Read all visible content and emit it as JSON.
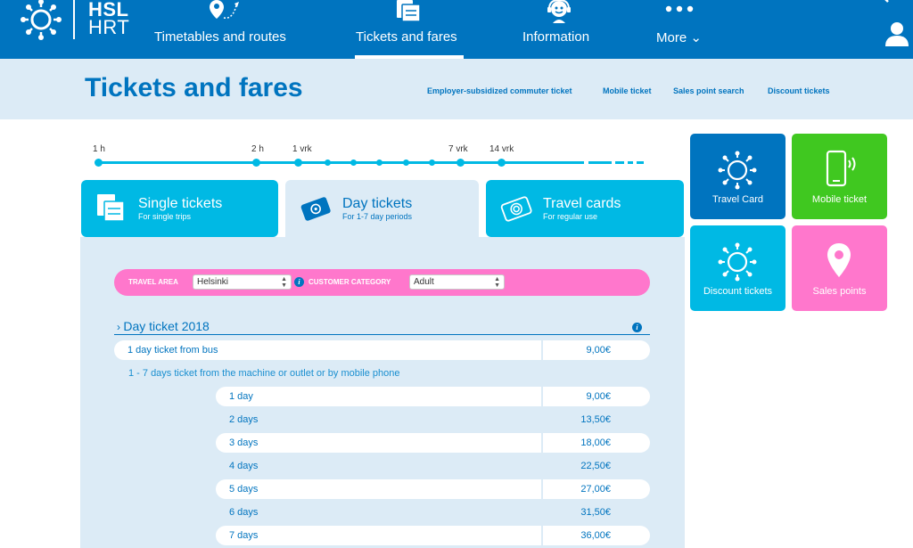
{
  "header": {
    "logo_line1": "HSL",
    "logo_line2": "HRT",
    "nav": [
      {
        "label": "Timetables and routes"
      },
      {
        "label": "Tickets and fares"
      },
      {
        "label": "Information"
      },
      {
        "label": "More ⌄"
      }
    ]
  },
  "subheader": {
    "title": "Tickets and fares",
    "links": [
      {
        "label": "Employer-subsidized commuter ticket"
      },
      {
        "label": "Mobile ticket"
      },
      {
        "label": "Sales point search"
      },
      {
        "label": "Discount tickets"
      }
    ]
  },
  "timeline": {
    "labels": [
      "1 h",
      "2 h",
      "1 vrk",
      "7 vrk",
      "14 vrk"
    ]
  },
  "tabs": [
    {
      "title": "Single tickets",
      "subtitle": "For single trips"
    },
    {
      "title": "Day tickets",
      "subtitle": "For 1-7 day periods"
    },
    {
      "title": "Travel cards",
      "subtitle": "For regular use"
    }
  ],
  "filters": {
    "travel_area_label": "TRAVEL AREA",
    "travel_area_value": "Helsinki",
    "customer_category_label": "CUSTOMER CATEGORY",
    "customer_category_value": "Adult"
  },
  "section": {
    "title": "Day ticket 2018",
    "bus_row": {
      "label": "1 day ticket from bus",
      "price": "9,00€"
    },
    "group_label": "1 - 7 days ticket from the machine or outlet or by mobile phone",
    "rows": [
      {
        "label": "1 day",
        "price": "9,00€"
      },
      {
        "label": "2 days",
        "price": "13,50€"
      },
      {
        "label": "3 days",
        "price": "18,00€"
      },
      {
        "label": "4 days",
        "price": "22,50€"
      },
      {
        "label": "5 days",
        "price": "27,00€"
      },
      {
        "label": "6 days",
        "price": "31,50€"
      },
      {
        "label": "7 days",
        "price": "36,00€"
      }
    ]
  },
  "tiles": [
    {
      "label": "Travel Card",
      "color": "#0074bf"
    },
    {
      "label": "Mobile ticket",
      "color": "#40c820"
    },
    {
      "label": "Discount tickets",
      "color": "#00b9e4"
    },
    {
      "label": "Sales points",
      "color": "#ff77cc"
    }
  ],
  "colors": {
    "brand_blue": "#0074bf",
    "accent_cyan": "#00b9e4",
    "panel_bg": "#dcebf6",
    "filter_pink": "#ff77cc"
  }
}
